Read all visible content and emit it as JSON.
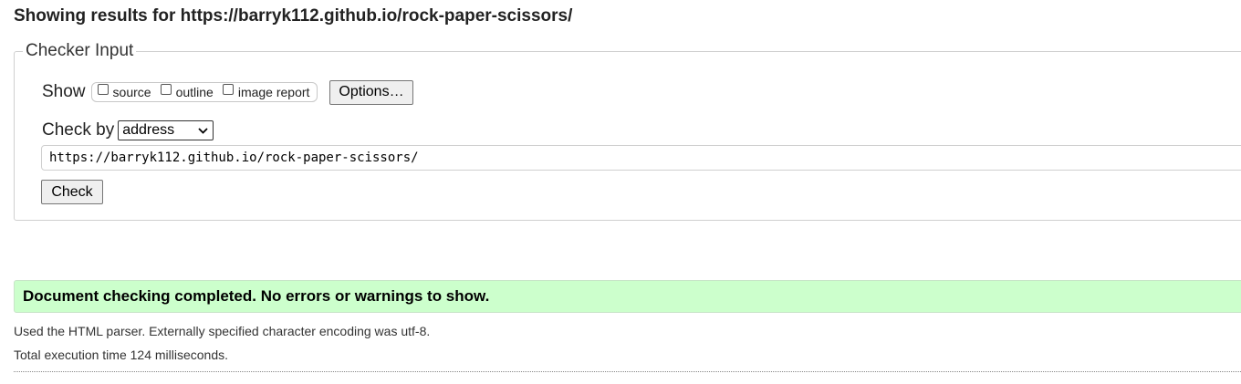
{
  "results": {
    "heading_prefix": "Showing results for",
    "url": "https://barryk112.github.io/rock-paper-scissors/"
  },
  "checker": {
    "legend": "Checker Input",
    "show_label": "Show",
    "show_options": [
      {
        "label": "source",
        "checked": false
      },
      {
        "label": "outline",
        "checked": false
      },
      {
        "label": "image report",
        "checked": false
      }
    ],
    "options_button": "Options…",
    "check_by_label": "Check by",
    "check_by_value": "address",
    "url_input_value": "https://barryk112.github.io/rock-paper-scissors/",
    "check_button": "Check"
  },
  "status": {
    "message": "Document checking completed. No errors or warnings to show.",
    "accent_color": "#ccffcc"
  },
  "info": {
    "parser_line": "Used the HTML parser. Externally specified character encoding was utf-8.",
    "time_line": "Total execution time 124 milliseconds."
  }
}
